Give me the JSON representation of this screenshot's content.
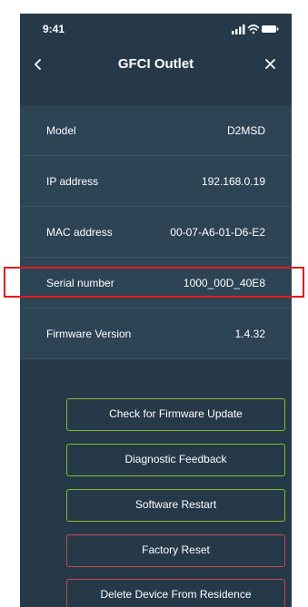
{
  "status_bar": {
    "time": "9:41"
  },
  "nav": {
    "title": "GFCI Outlet"
  },
  "info_rows": [
    {
      "label": "Model",
      "value": "D2MSD"
    },
    {
      "label": "IP address",
      "value": "192.168.0.19"
    },
    {
      "label": "MAC address",
      "value": "00-07-A6-01-D6-E2"
    },
    {
      "label": "Serial number",
      "value": "1000_00D_40E8"
    },
    {
      "label": "Firmware Version",
      "value": "1.4.32"
    }
  ],
  "buttons": {
    "check_firmware": "Check for Firmware Update",
    "diagnostic": "Diagnostic Feedback",
    "restart": "Software Restart",
    "factory_reset": "Factory Reset",
    "delete_device": "Delete Device From Residence"
  },
  "colors": {
    "background": "#253949",
    "row": "#2d4455",
    "accent_green": "#7fbf2a",
    "danger_red": "#c9474c",
    "highlight": "#e21b1b"
  }
}
